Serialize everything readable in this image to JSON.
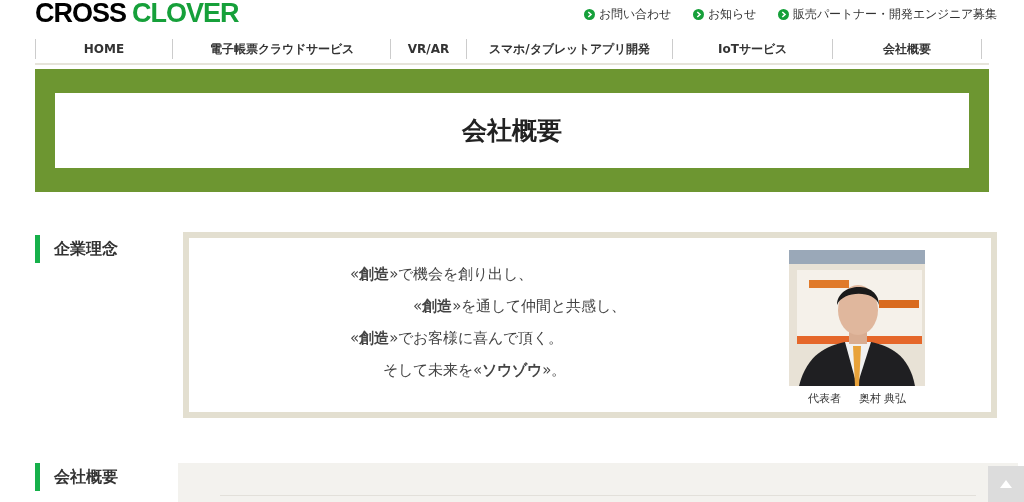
{
  "logo": {
    "part_1": "CROSS",
    "part_2": "CLOVER"
  },
  "top_links": [
    "お問い合わせ",
    "お知らせ",
    "販売パートナー・開発エンジニア募集"
  ],
  "nav": [
    {
      "label": "HOME"
    },
    {
      "label": "電子帳票クラウドサービス"
    },
    {
      "label": "VR/AR"
    },
    {
      "label": "スマホ/タブレットアプリ開発"
    },
    {
      "label": "IoTサービス"
    },
    {
      "label": "会社概要"
    }
  ],
  "page_title": "会社概要",
  "sections": [
    {
      "heading": "企業理念",
      "philosophy": [
        "«**創造**»で機会を創り出し、",
        "«**創造**»を通して仲間と共感し、",
        "«**創造**»でお客様に喜んで頂く。",
        "そして未来を«**ソウゾウ**»。"
      ],
      "photo": {
        "kind": "picture",
        "caption_role": "代表者",
        "caption_name": "奥村 典弘"
      }
    },
    {
      "heading": "会社概要"
    }
  ],
  "back_to_top": {
    "kind": "button"
  }
}
